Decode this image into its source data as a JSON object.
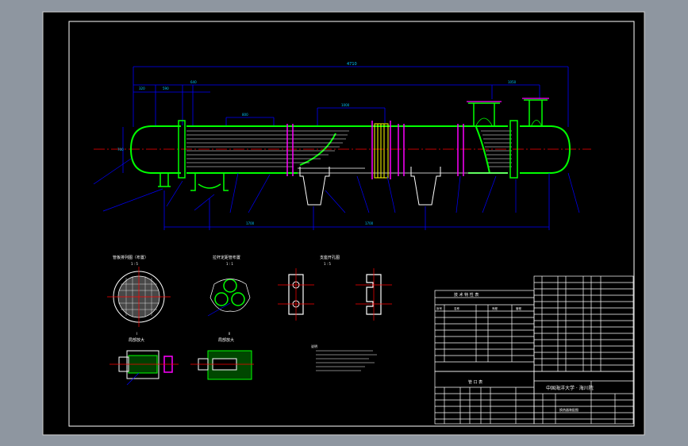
{
  "colors": {
    "viewport_bg": "#8e96a0",
    "sheet_bg": "#000000",
    "frame": "#ffffff",
    "outline": "#00ff00",
    "center_line": "#ff0000",
    "dimension": "#0000ff",
    "leader": "#0000ff",
    "flange": "#ff00ff",
    "text": "#ffffff",
    "highlight": "#ffff00"
  },
  "main_view": {
    "overall_dimension": "4710",
    "top_dims": [
      "320",
      "590",
      "640",
      "800",
      "1050",
      "600"
    ],
    "nozzle_dims": [
      "150",
      "300"
    ],
    "baffle_label": "1000",
    "left_height": "700",
    "bottom_dims": [
      "1700",
      "1700",
      "1600"
    ]
  },
  "detail_views": {
    "tubesheet_title": "管板排列图（布置）",
    "tubesheet_scale": "1 : 5",
    "tie_rod_title": "拉杆定距管布置",
    "tie_rod_scale": "1 : 1",
    "support_title": "支座开孔图",
    "support_scale": "1 : 5",
    "detail_1_num": "I",
    "detail_1_title": "局部放大",
    "detail_2_num": "II",
    "detail_2_title": "局部放大"
  },
  "notes_title": "说明",
  "tables": {
    "spec_title": "技 术 特 性 表",
    "spec_cols": [
      "序号",
      "名称",
      "壳程",
      "管程"
    ],
    "nozzle_title": "管 口 表",
    "company": "中国海洋大学 · 海川院",
    "drawing_no": "换热器装配图"
  }
}
